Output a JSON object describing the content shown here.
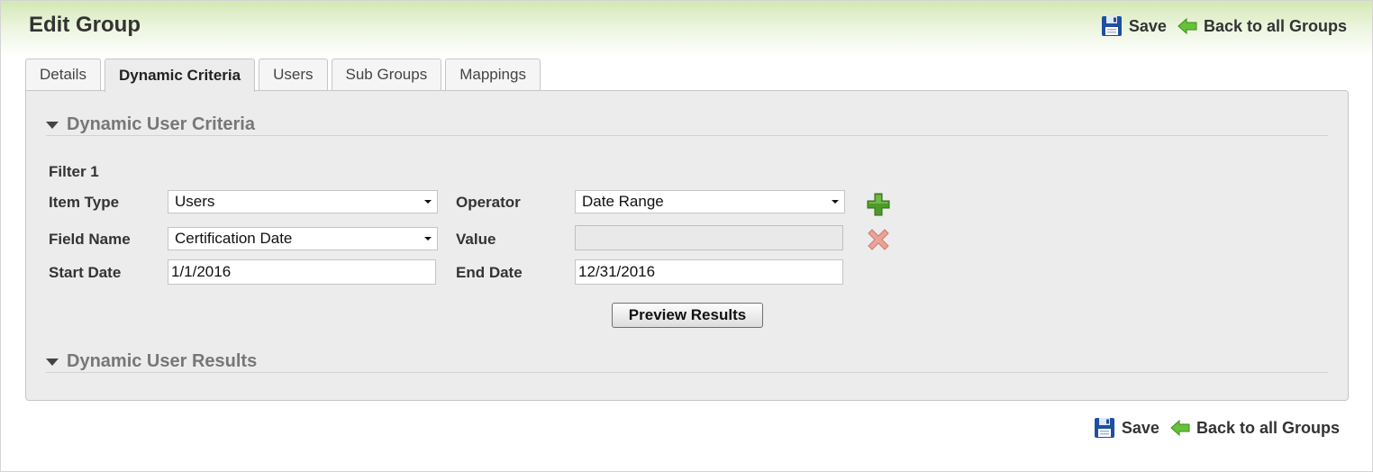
{
  "header": {
    "title": "Edit Group",
    "save_label": "Save",
    "back_label": "Back to all Groups"
  },
  "tabs": [
    {
      "label": "Details",
      "active": false
    },
    {
      "label": "Dynamic Criteria",
      "active": true
    },
    {
      "label": "Users",
      "active": false
    },
    {
      "label": "Sub Groups",
      "active": false
    },
    {
      "label": "Mappings",
      "active": false
    }
  ],
  "criteria": {
    "section_title": "Dynamic User Criteria",
    "filter_title": "Filter 1",
    "item_type_label": "Item Type",
    "item_type_value": "Users",
    "operator_label": "Operator",
    "operator_value": "Date Range",
    "field_name_label": "Field Name",
    "field_name_value": "Certification Date",
    "value_label": "Value",
    "value_value": "",
    "start_date_label": "Start Date",
    "start_date_value": "1/1/2016",
    "end_date_label": "End Date",
    "end_date_value": "12/31/2016",
    "add_icon": "plus-icon",
    "remove_icon": "x-icon",
    "preview_label": "Preview Results"
  },
  "results": {
    "section_title": "Dynamic User Results"
  },
  "footer": {
    "save_label": "Save",
    "back_label": "Back to all Groups"
  },
  "colors": {
    "header_gradient": "#d3e8b3",
    "panel_bg": "#ececec",
    "add_green": "#4c9a2a",
    "remove_red": "#e8a39a",
    "save_blue": "#1f4fa0",
    "back_green": "#66c23a"
  }
}
